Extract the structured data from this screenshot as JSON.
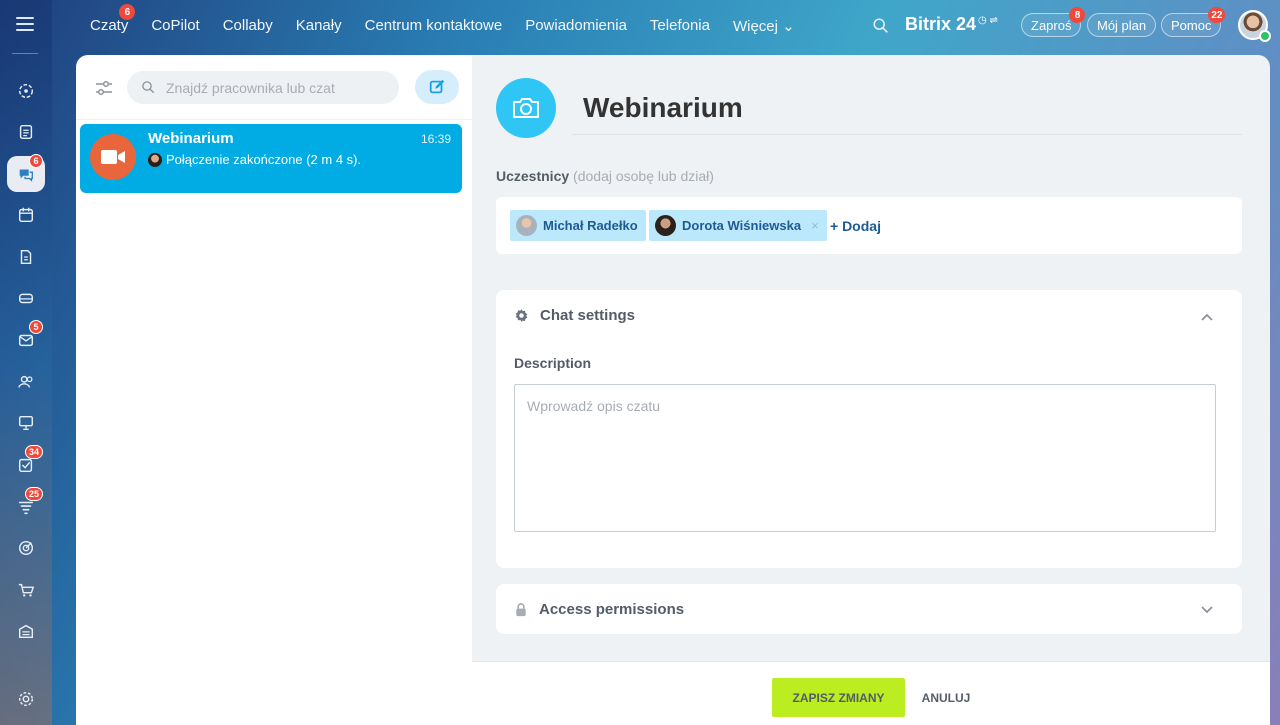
{
  "nav": {
    "items": [
      {
        "label": "Czaty",
        "badge": "6"
      },
      {
        "label": "CoPilot",
        "badge": ""
      },
      {
        "label": "Collaby",
        "badge": ""
      },
      {
        "label": "Kanały",
        "badge": ""
      },
      {
        "label": "Centrum kontaktowe",
        "badge": ""
      },
      {
        "label": "Powiadomienia",
        "badge": ""
      },
      {
        "label": "Telefonia",
        "badge": ""
      },
      {
        "label": "Więcej ⌄",
        "badge": ""
      }
    ],
    "brand": "Bitrix 24",
    "invite": {
      "label": "Zaproś",
      "badge": "8"
    },
    "plan": {
      "label": "Mój plan"
    },
    "help": {
      "label": "Pomoc",
      "badge": "22"
    }
  },
  "rail": {
    "badges": {
      "chats": "6",
      "mail": "5",
      "tasks": "34",
      "crm": "25"
    }
  },
  "search": {
    "placeholder": "Znajdź pracownika lub czat"
  },
  "chat_list": [
    {
      "title": "Webinarium",
      "time": "16:39",
      "preview": "Połączenie zakończone (2 m 4 s)."
    }
  ],
  "chat_settings": {
    "title": "Webinarium",
    "participants_label": "Uczestnicy",
    "participants_hint": "(dodaj osobę lub dział)",
    "participants": [
      {
        "name": "Michał Radełko"
      },
      {
        "name": "Dorota Wiśniewska",
        "remove": "×"
      }
    ],
    "add_label": "+ Dodaj",
    "settings_header": "Chat settings",
    "description_label": "Description",
    "description_placeholder": "Wprowadź opis czatu",
    "access_header": "Access permissions"
  },
  "footer": {
    "save_label": "ZAPISZ ZMIANY",
    "cancel_label": "ANULUJ"
  },
  "colors": {
    "accent": "#00ace3",
    "save": "#bbed21",
    "badge": "#f0493c"
  }
}
